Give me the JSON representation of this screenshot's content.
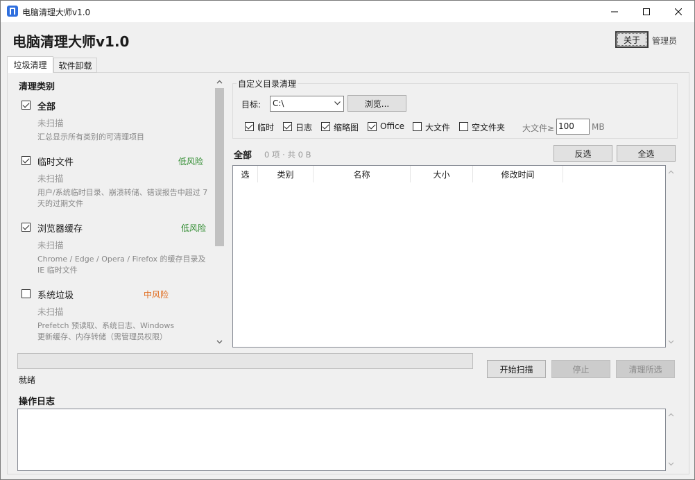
{
  "window": {
    "title": "电脑清理大师v1.0"
  },
  "header": {
    "title": "电脑清理大师v1.0",
    "about_label": "关于",
    "role_label": "管理员"
  },
  "tabs": [
    {
      "label": "垃圾清理",
      "active": true
    },
    {
      "label": "软件卸载",
      "active": false
    }
  ],
  "categories": {
    "heading": "清理类别",
    "items": [
      {
        "name": "全部",
        "checked": true,
        "status": "未扫描",
        "description": "汇总显示所有类别的可清理项目",
        "risk": "",
        "risk_color": ""
      },
      {
        "name": "临时文件",
        "checked": true,
        "status": "未扫描",
        "description": "用户/系统临时目录、崩溃转储、错误报告中超过 7 天的过期文件",
        "risk": "低风险",
        "risk_color": "#2e8b2e"
      },
      {
        "name": "浏览器缓存",
        "checked": true,
        "status": "未扫描",
        "description": "Chrome / Edge / Opera / Firefox 的缓存目录及 IE 临时文件",
        "risk": "低风险",
        "risk_color": "#2e8b2e"
      },
      {
        "name": "系统垃圾",
        "checked": false,
        "status": "未扫描",
        "description": "Prefetch 预读取、系统日志、Windows 更新缓存、内存转储（需管理员权限）",
        "risk": "中风险",
        "risk_color": "#e06a1b"
      }
    ]
  },
  "custom_dir": {
    "legend": "自定义目录清理",
    "target_label": "目标:",
    "target_value": "C:\\",
    "browse_label": "浏览...",
    "options": [
      {
        "label": "临时",
        "checked": true
      },
      {
        "label": "日志",
        "checked": true
      },
      {
        "label": "缩略图",
        "checked": true
      },
      {
        "label": "Office",
        "checked": true
      },
      {
        "label": "大文件",
        "checked": false
      },
      {
        "label": "空文件夹",
        "checked": false
      }
    ],
    "bigfile_label": "大文件≥",
    "bigfile_value": "100",
    "bigfile_unit": "MB"
  },
  "list": {
    "title": "全部",
    "summary": "0 项 · 共 0 B",
    "invert_label": "反选",
    "select_all_label": "全选",
    "columns": [
      "选",
      "类别",
      "名称",
      "大小",
      "修改时间"
    ]
  },
  "progress": {
    "value": 0
  },
  "status": {
    "text": "就绪"
  },
  "actions": {
    "start_label": "开始扫描",
    "stop_label": "停止",
    "clean_label": "清理所选"
  },
  "log": {
    "title": "操作日志"
  },
  "colors": {
    "accent": "#2f6fde",
    "low_risk": "#2e8b2e",
    "mid_risk": "#e06a1b"
  }
}
